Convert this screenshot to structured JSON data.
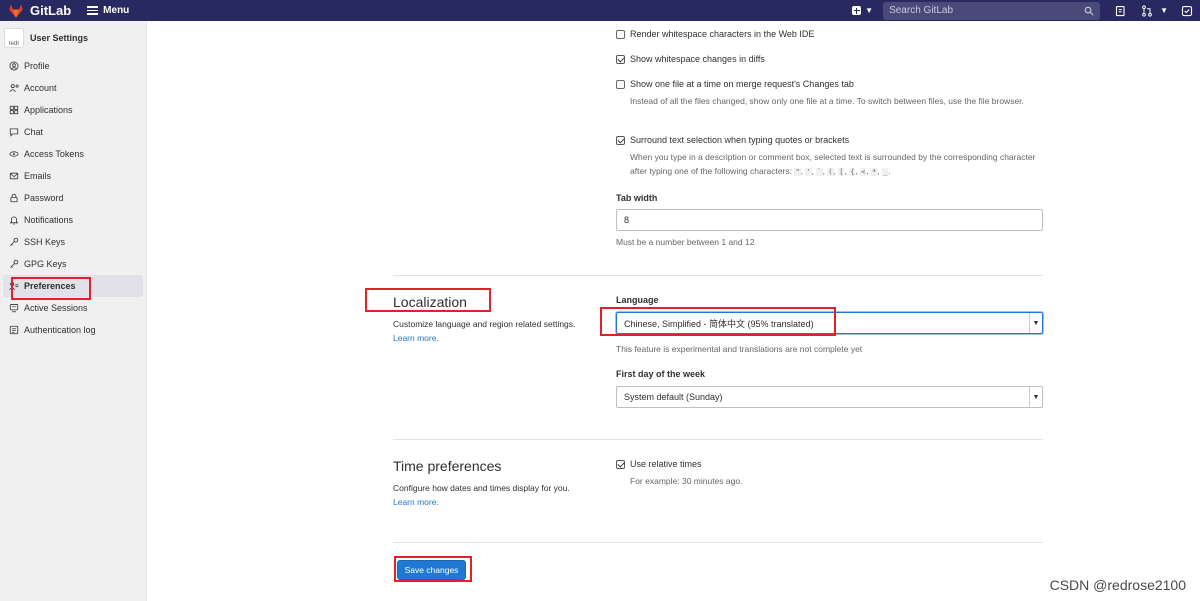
{
  "topbar": {
    "app_name": "GitLab",
    "menu_label": "Menu",
    "search_placeholder": "Search GitLab",
    "colors": {
      "bg": "#292961",
      "logo": "#e24329"
    }
  },
  "sidebar": {
    "title": "User Settings",
    "avatar_alt": "redr",
    "items": [
      {
        "label": "Profile",
        "icon": "user-icon"
      },
      {
        "label": "Account",
        "icon": "account-icon"
      },
      {
        "label": "Applications",
        "icon": "applications-icon"
      },
      {
        "label": "Chat",
        "icon": "chat-icon"
      },
      {
        "label": "Access Tokens",
        "icon": "token-icon"
      },
      {
        "label": "Emails",
        "icon": "mail-icon"
      },
      {
        "label": "Password",
        "icon": "lock-icon"
      },
      {
        "label": "Notifications",
        "icon": "bell-icon"
      },
      {
        "label": "SSH Keys",
        "icon": "key-icon"
      },
      {
        "label": "GPG Keys",
        "icon": "key-icon"
      },
      {
        "label": "Preferences",
        "icon": "preferences-icon",
        "active": true
      },
      {
        "label": "Active Sessions",
        "icon": "monitor-icon"
      },
      {
        "label": "Authentication log",
        "icon": "list-icon"
      }
    ]
  },
  "behavior": {
    "render_whitespace": {
      "label": "Render whitespace characters in the Web IDE",
      "checked": false
    },
    "show_whitespace": {
      "label": "Show whitespace changes in diffs",
      "checked": true
    },
    "one_file": {
      "label": "Show one file at a time on merge request's Changes tab",
      "checked": false,
      "help": "Instead of all the files changed, show only one file at a time. To switch between files, use the file browser."
    },
    "surround": {
      "label": "Surround text selection when typing quotes or brackets",
      "checked": true,
      "help_prefix": "When you type in a description or comment box, selected text is surrounded by the corresponding character after typing one of the following characters: ",
      "chars": [
        "\"",
        "'",
        "`",
        "(",
        "[",
        "{",
        "<",
        "*",
        "_"
      ]
    },
    "tab_width": {
      "label": "Tab width",
      "value": "8",
      "note": "Must be a number between 1 and 12"
    }
  },
  "localization": {
    "title": "Localization",
    "desc": "Customize language and region related settings.",
    "learn_more": "Learn more.",
    "language_label": "Language",
    "language_value": "Chinese, Simplified - 简体中文 (95% translated)",
    "language_note": "This feature is experimental and translations are not complete yet",
    "first_day_label": "First day of the week",
    "first_day_value": "System default (Sunday)"
  },
  "time": {
    "title": "Time preferences",
    "desc": "Configure how dates and times display for you.",
    "learn_more": "Learn more.",
    "relative": {
      "label": "Use relative times",
      "checked": true,
      "help": "For example: 30 minutes ago."
    }
  },
  "save_label": "Save changes",
  "watermark": "CSDN @redrose2100",
  "colors": {
    "primary": "#1f78d1",
    "highlight": "#e0202a"
  }
}
